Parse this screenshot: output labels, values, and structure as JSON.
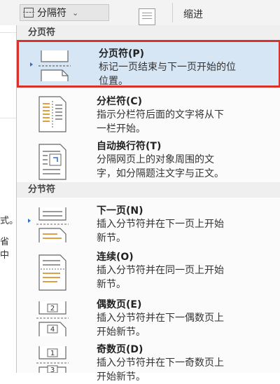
{
  "ribbon": {
    "breaks_button_label": "分隔符",
    "chevron": "⌄",
    "indent_label": "缩进"
  },
  "doc_left": {
    "fragment_1": "式。",
    "fragment_2": "省中"
  },
  "menu": {
    "page_breaks_header": "分页符",
    "section_breaks_header": "分节符",
    "page_items": [
      {
        "title": "分页符(P)",
        "desc": [
          "标记一页结束与下一页开始的位",
          "位置。"
        ],
        "icon": "page-break-icon"
      },
      {
        "title": "分栏符(C)",
        "desc": [
          "指示分栏符后面的文字将从下",
          "一栏开始。"
        ],
        "icon": "column-break-icon"
      },
      {
        "title": "自动换行符(T)",
        "desc": [
          "分隔网页上的对象周围的文",
          "字，如分隔题注文字与正文。"
        ],
        "icon": "text-wrapping-icon"
      }
    ],
    "section_items": [
      {
        "title": "下一页(N)",
        "desc": [
          "插入分节符并在下一页上开始",
          "新节。"
        ],
        "icon": "next-page-icon"
      },
      {
        "title": "连续(O)",
        "desc": [
          "插入分节符并在同一页上开始",
          "新节。"
        ],
        "icon": "continuous-icon"
      },
      {
        "title": "偶数页(E)",
        "desc": [
          "插入分节符并在下一偶数页上",
          "开始新节。"
        ],
        "icon": "even-page-icon"
      },
      {
        "title": "奇数页(D)",
        "desc": [
          "插入分节符并在下一奇数页上",
          "开始新节。"
        ],
        "icon": "odd-page-icon"
      }
    ]
  },
  "colors": {
    "selected_background": "#d7e6f5",
    "highlight_border": "#d9312b",
    "marker": "#2f6fc4"
  }
}
